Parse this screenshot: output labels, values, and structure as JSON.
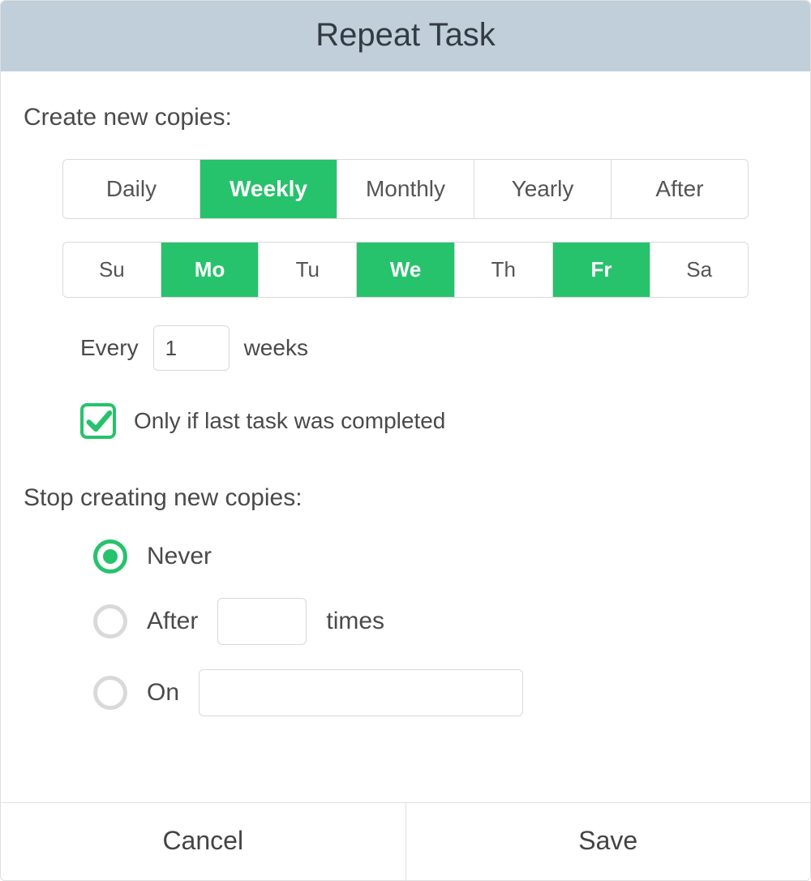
{
  "title": "Repeat Task",
  "create": {
    "label": "Create new copies:",
    "frequency": {
      "options": [
        "Daily",
        "Weekly",
        "Monthly",
        "Yearly",
        "After"
      ],
      "selected": "Weekly"
    },
    "days": {
      "options": [
        "Su",
        "Mo",
        "Tu",
        "We",
        "Th",
        "Fr",
        "Sa"
      ],
      "selected": [
        "Mo",
        "We",
        "Fr"
      ]
    },
    "every": {
      "prefix": "Every",
      "value": "1",
      "suffix": "weeks"
    },
    "only_if": {
      "checked": true,
      "label": "Only if last task was completed"
    }
  },
  "stop": {
    "label": "Stop creating new copies:",
    "selected": "never",
    "never": {
      "label": "Never"
    },
    "after": {
      "prefix": "After",
      "value": "",
      "suffix": "times"
    },
    "on": {
      "prefix": "On",
      "value": ""
    }
  },
  "footer": {
    "cancel": "Cancel",
    "save": "Save"
  },
  "colors": {
    "accent": "#27c26c",
    "header_bg": "#c0cfda"
  }
}
